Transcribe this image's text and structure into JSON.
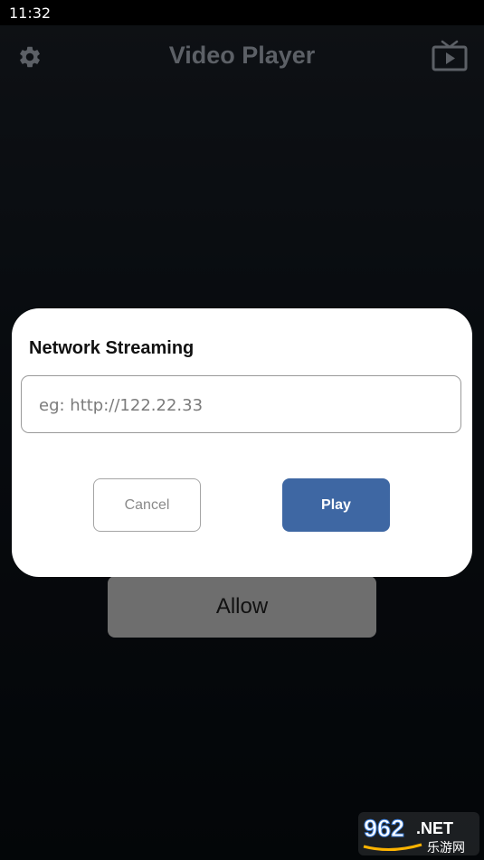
{
  "status_bar": {
    "time": "11:32"
  },
  "app_bar": {
    "title": "Video Player",
    "left_icon": "gear-icon",
    "right_icon": "tv-play-icon"
  },
  "background_button": {
    "label": "Allow"
  },
  "dialog": {
    "title": "Network Streaming",
    "input": {
      "value": "",
      "placeholder": "eg: http://122.22.33"
    },
    "cancel_label": "Cancel",
    "play_label": "Play"
  },
  "watermark": {
    "text": "962.NET 乐游网"
  },
  "colors": {
    "accent": "#3e67a3",
    "app_title": "#5c6066",
    "allow_button": "#6e6e6e",
    "dialog_bg": "#ffffff"
  }
}
